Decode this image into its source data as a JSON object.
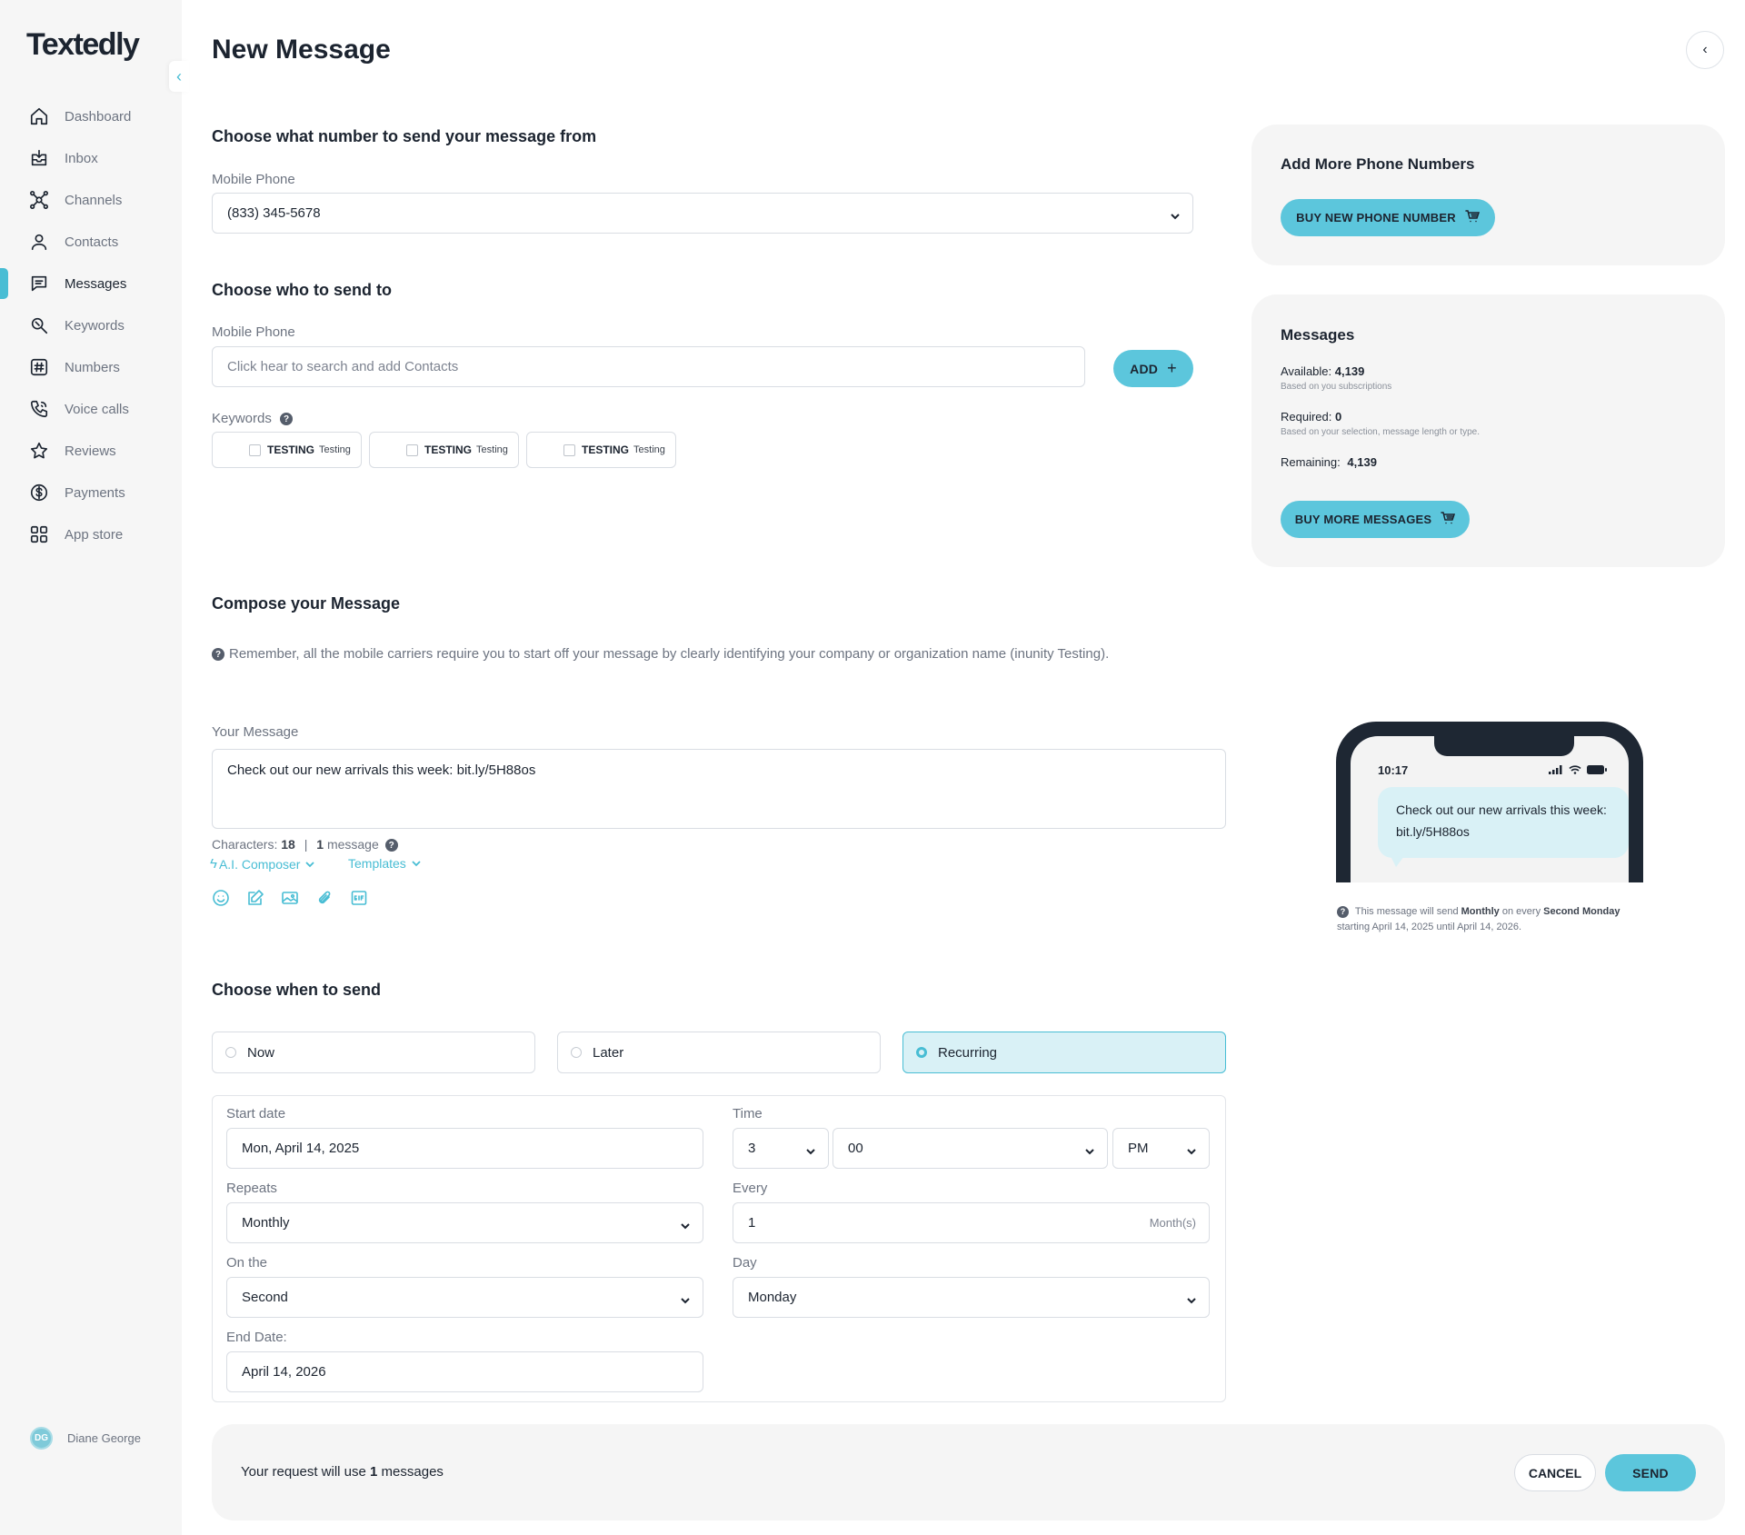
{
  "app": {
    "logo": "Textedly",
    "user_initials": "DG",
    "user_name": "Diane George"
  },
  "sidebar": {
    "items": [
      {
        "label": "Dashboard",
        "icon": "home-icon"
      },
      {
        "label": "Inbox",
        "icon": "inbox-icon"
      },
      {
        "label": "Channels",
        "icon": "channels-icon"
      },
      {
        "label": "Contacts",
        "icon": "user-icon"
      },
      {
        "label": "Messages",
        "icon": "message-icon",
        "active": true
      },
      {
        "label": "Keywords",
        "icon": "keyword-icon"
      },
      {
        "label": "Numbers",
        "icon": "hash-icon"
      },
      {
        "label": "Voice calls",
        "icon": "phone-icon"
      },
      {
        "label": "Reviews",
        "icon": "star-icon"
      },
      {
        "label": "Payments",
        "icon": "dollar-icon"
      },
      {
        "label": "App store",
        "icon": "grid-icon"
      }
    ]
  },
  "page": {
    "title": "New Message"
  },
  "from": {
    "title": "Choose what number to send your message from",
    "label": "Mobile Phone",
    "value": "(833) 345-5678"
  },
  "to": {
    "title": "Choose who to send to",
    "label": "Mobile Phone",
    "placeholder": "Click hear to search and add Contacts",
    "add_label": "ADD",
    "add_icon": "+",
    "keywords_label": "Keywords",
    "keywords": [
      {
        "name": "TESTING",
        "sub": "Testing"
      },
      {
        "name": "TESTING",
        "sub": "Testing"
      },
      {
        "name": "TESTING",
        "sub": "Testing"
      }
    ]
  },
  "compose": {
    "title": "Compose your Message",
    "note": "Remember, all the mobile carriers require you to start off your message by clearly identifying your company or organization name (inunity Testing).",
    "label": "Your Message",
    "message": "Check out our new arrivals this week: bit.ly/5H88os",
    "characters_label": "Characters:",
    "characters": "18",
    "separator": "|",
    "message_count": "1",
    "message_word": "message",
    "ai_composer": "A.I. Composer",
    "templates": "Templates"
  },
  "schedule": {
    "title": "Choose when to send",
    "options": [
      "Now",
      "Later",
      "Recurring"
    ],
    "selected": "Recurring",
    "start_date_label": "Start date",
    "start_date": "Mon, April 14, 2025",
    "time_label": "Time",
    "hour": "3",
    "minute": "00",
    "ampm": "PM",
    "repeats_label": "Repeats",
    "repeats": "Monthly",
    "every_label": "Every",
    "every": "1",
    "every_unit": "Month(s)",
    "on_the_label": "On the",
    "on_the": "Second",
    "day_label": "Day",
    "day": "Monday",
    "end_date_label": "End Date:",
    "end_date": "April 14, 2026"
  },
  "numbers_panel": {
    "title": "Add More Phone Numbers",
    "button": "BUY NEW PHONE NUMBER"
  },
  "messages_panel": {
    "title": "Messages",
    "available_label": "Available:",
    "available": "4,139",
    "available_note": "Based on you subscriptions",
    "required_label": "Required:",
    "required": "0",
    "required_note": "Based on your selection, message length or type.",
    "remaining_label": "Remaining:",
    "remaining": "4,139",
    "button": "BUY MORE MESSAGES"
  },
  "preview": {
    "time": "10:17",
    "message": "Check out our new arrivals this week: bit.ly/5H88os",
    "note_a": "This message will send",
    "note_freq": "Monthly",
    "note_b": "on every",
    "note_ord": "Second",
    "note_day": "Monday",
    "note_c": "starting April 14, 2025 until April 14, 2026."
  },
  "footer": {
    "text_a": "Your request will use",
    "count": "1",
    "text_b": "messages",
    "cancel": "CANCEL",
    "send": "SEND"
  },
  "colors": {
    "accent": "#5cc6dc",
    "accent_light": "#d9f1f6",
    "text": "#1c2430",
    "muted": "#6c7380"
  }
}
